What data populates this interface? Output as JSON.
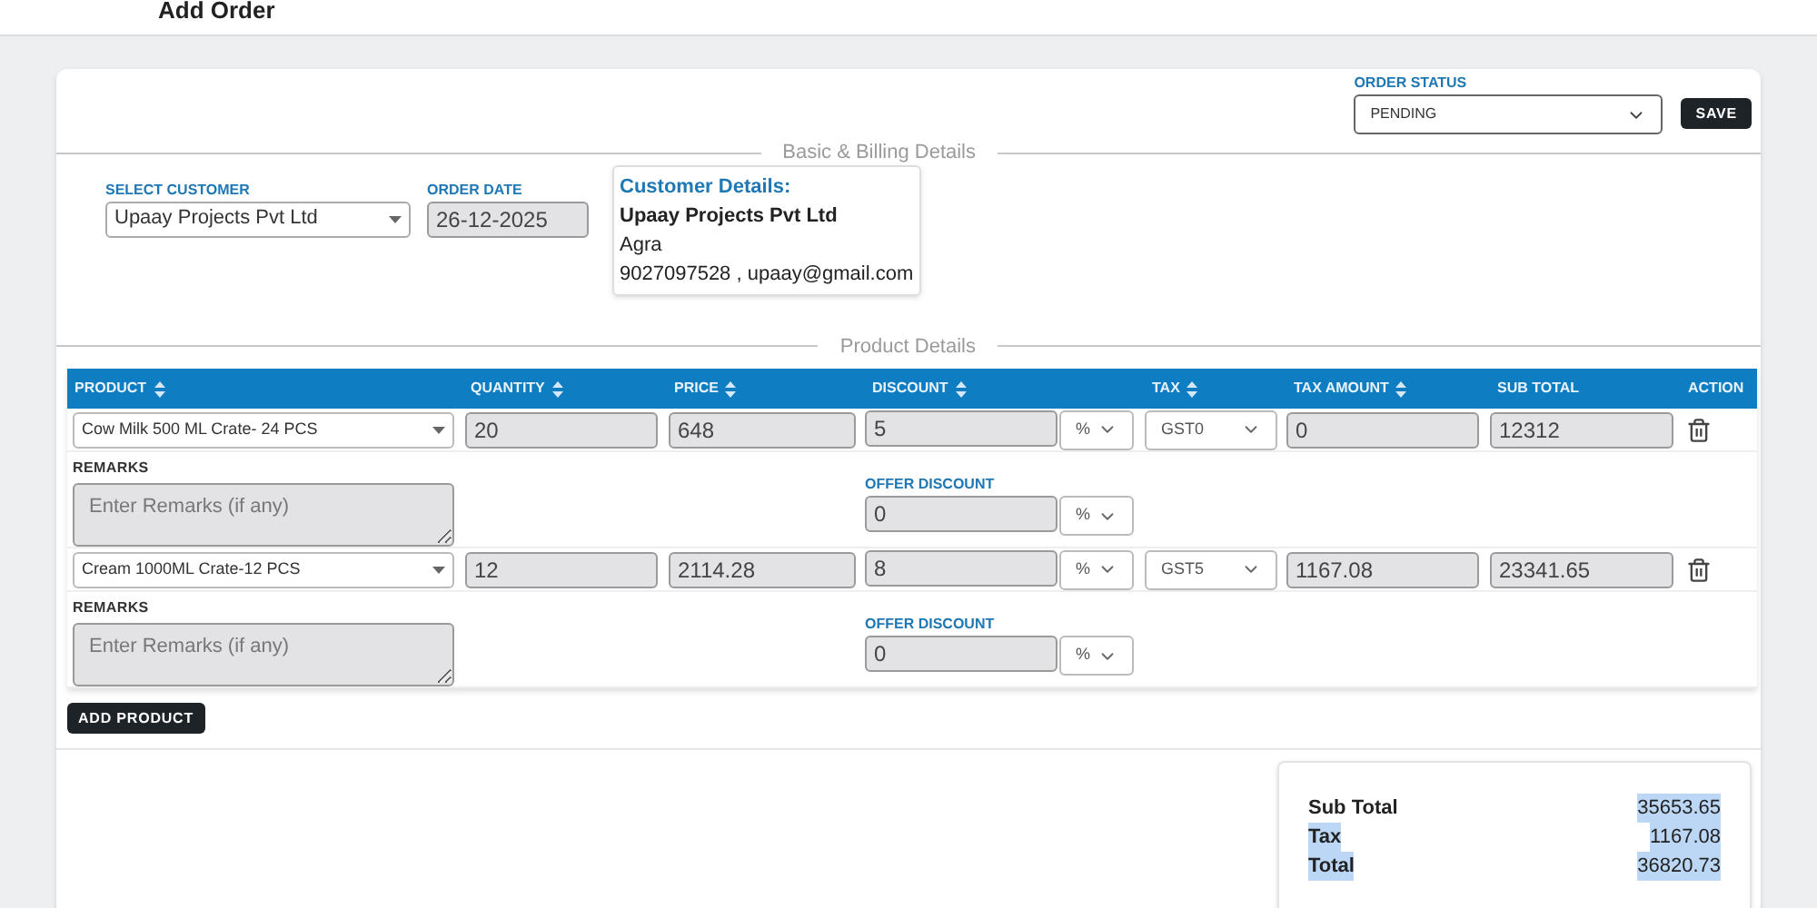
{
  "header": {
    "title": "Add Order"
  },
  "order_status": {
    "label": "ORDER STATUS",
    "value": "PENDING"
  },
  "save_button": "SAVE",
  "basic_section": {
    "title": "Basic & Billing Details",
    "customer": {
      "label": "SELECT CUSTOMER",
      "value": "Upaay Projects Pvt Ltd"
    },
    "order_date": {
      "label": "ORDER DATE",
      "value": "26-12-2025"
    },
    "customer_details": {
      "title": "Customer Details:",
      "name": "Upaay Projects Pvt Ltd",
      "city": "Agra",
      "contact": "9027097528 , upaay@gmail.com"
    }
  },
  "product_section": {
    "title": "Product Details",
    "columns": [
      {
        "label": "PRODUCT",
        "sortable": true
      },
      {
        "label": "QUANTITY",
        "sortable": true
      },
      {
        "label": "PRICE",
        "sortable": true
      },
      {
        "label": "DISCOUNT",
        "sortable": true
      },
      {
        "label": "TAX",
        "sortable": true
      },
      {
        "label": "TAX AMOUNT",
        "sortable": true
      },
      {
        "label": "SUB TOTAL",
        "sortable": false
      },
      {
        "label": "ACTION",
        "sortable": false
      }
    ],
    "rows": [
      {
        "product": "Cow Milk 500 ML Crate- 24 PCS",
        "quantity": "20",
        "price": "648",
        "discount": "5",
        "discount_type": "%",
        "tax": "GST0",
        "tax_amount": "0",
        "sub_total": "12312",
        "remarks_label": "REMARKS",
        "remarks_placeholder": "Enter Remarks (if any)",
        "offer_label": "OFFER DISCOUNT",
        "offer_discount": "0",
        "offer_type": "%"
      },
      {
        "product": "Cream 1000ML Crate-12 PCS",
        "quantity": "12",
        "price": "2114.28",
        "discount": "8",
        "discount_type": "%",
        "tax": "GST5",
        "tax_amount": "1167.08",
        "sub_total": "23341.65",
        "remarks_label": "REMARKS",
        "remarks_placeholder": "Enter Remarks (if any)",
        "offer_label": "OFFER DISCOUNT",
        "offer_discount": "0",
        "offer_type": "%"
      }
    ]
  },
  "add_product_button": "ADD PRODUCT",
  "summary": [
    {
      "label": "Sub Total",
      "value": "35653.65",
      "label_highlighted": false,
      "value_highlighted": true
    },
    {
      "label": "Tax",
      "value": "1167.08",
      "label_highlighted": true,
      "value_highlighted": true
    },
    {
      "label": "Total",
      "value": "36820.73",
      "label_highlighted": true,
      "value_highlighted": true
    }
  ]
}
